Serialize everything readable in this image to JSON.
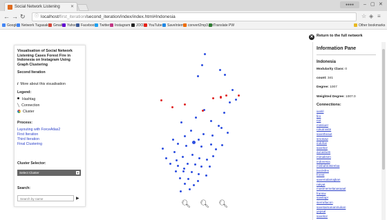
{
  "browser": {
    "tab_title": "Social Network Listening",
    "url_host": "localhost/",
    "url_dim": "first_iteration",
    "url_rest": "/second_iteration/index/index.html#Indonesia",
    "other_bookmarks": "Other bookmarks",
    "bookmarks": [
      {
        "label": "Google",
        "color": "#4285f4"
      },
      {
        "label": "Network Tugasakhir",
        "color": "#4285f4"
      },
      {
        "label": "Gmail",
        "color": "#d44638"
      },
      {
        "label": "Yahoo",
        "color": "#6001d2"
      },
      {
        "label": "Facebook",
        "color": "#3b5998"
      },
      {
        "label": "Twitter",
        "color": "#1da1f2"
      },
      {
        "label": "Instagram",
        "color": "#c13584"
      },
      {
        "label": "JOOX",
        "color": "#222222"
      },
      {
        "label": "YouTube",
        "color": "#e62117"
      },
      {
        "label": "SaveInternet",
        "color": "#1e88e5"
      },
      {
        "label": "convert2mp3.net",
        "color": "#ef6c00"
      },
      {
        "label": "Translate PW",
        "color": "#2e7d32"
      }
    ]
  },
  "left_panel": {
    "title": "Visualisation of Social Network Listening Cases Forest Fire in Indonesia on Instagram Using Graph Clustering",
    "iteration": "Second Iteration",
    "more_about": "More about this visualisation",
    "legend_heading": "Legend:",
    "legend_items": [
      "Hashtag",
      "Connection",
      "Cluster"
    ],
    "process_heading": "Process:",
    "process_links": [
      "Layouting with ForceAtlas2",
      "First Iteration",
      "Third Iteration",
      "Final Clustering"
    ],
    "cluster_heading": "Cluster Selector:",
    "cluster_select": "Select Cluster",
    "search_heading": "Search:",
    "search_placeholder": "Search by name"
  },
  "graph": {
    "colors": {
      "blue": "#2d4fe0",
      "red": "#e02424"
    },
    "back_button": "Return to the full network",
    "zoom_in_icon": "zoom-in-icon",
    "zoom_out_icon": "zoom-out-icon",
    "zoom_reset_icon": "zoom-reset-icon"
  },
  "info_pane": {
    "heading": "Information Pane",
    "node_name": "Indonesia",
    "modularity_label": "Modularity Class:",
    "modularity_value": "0",
    "count_label": "count:",
    "count_value": "341",
    "degree_label": "Degree:",
    "degree_value": "1007",
    "weighted_label": "Weighted Degree:",
    "weighted_value": "1007.0",
    "connections_heading": "Connections:",
    "connections": [
      "ianitil",
      "fire",
      "riot",
      "missiuer",
      "rokutmiste",
      "savetheaut",
      "smokaw",
      "indofoe",
      "savekor",
      "aunasiwis",
      "mimaksen",
      "indonesia",
      "misbahtotsirelaa",
      "bocilsfns",
      "forest",
      "savemalamajkan",
      "rakyat",
      "mastmemelanasaaal",
      "fransw",
      "sawitapr",
      "sierrafiacon",
      "savetaimananmukan",
      "yepsal",
      "savekor"
    ]
  }
}
